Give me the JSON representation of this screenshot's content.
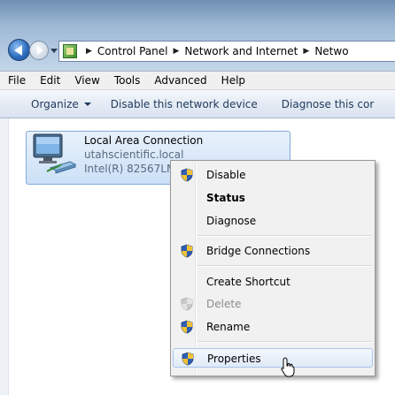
{
  "addressbar": {
    "crumbs": [
      "Control Panel",
      "Network and Internet",
      "Netwo"
    ]
  },
  "menubar": {
    "items": [
      "File",
      "Edit",
      "View",
      "Tools",
      "Advanced",
      "Help"
    ]
  },
  "commandbar": {
    "organize": "Organize",
    "disable": "Disable this network device",
    "diagnose": "Diagnose this cor"
  },
  "connection": {
    "name": "Local Area Connection",
    "domain": "utahscientific.local",
    "adapter": "Intel(R) 82567LM"
  },
  "context_menu": {
    "items": [
      {
        "label": "Disable",
        "shield": true,
        "bold": false,
        "enabled": true
      },
      {
        "label": "Status",
        "shield": false,
        "bold": true,
        "enabled": true
      },
      {
        "label": "Diagnose",
        "shield": false,
        "bold": false,
        "enabled": true
      },
      {
        "label": "Bridge Connections",
        "shield": true,
        "bold": false,
        "enabled": true
      },
      {
        "label": "Create Shortcut",
        "shield": false,
        "bold": false,
        "enabled": true
      },
      {
        "label": "Delete",
        "shield": true,
        "bold": false,
        "enabled": false
      },
      {
        "label": "Rename",
        "shield": true,
        "bold": false,
        "enabled": true
      },
      {
        "label": "Properties",
        "shield": true,
        "bold": false,
        "enabled": true,
        "highlighted": true
      }
    ]
  },
  "icons": {
    "back": "back-arrow-icon",
    "forward": "forward-arrow-icon",
    "control_panel": "control-panel-icon",
    "network": "network-connection-icon",
    "shield": "uac-shield-icon",
    "cursor": "mouse-pointer-icon"
  },
  "colors": {
    "selection": "#cce0f6",
    "menu_highlight": "#dfeaf8",
    "link_text": "#1e395b"
  }
}
